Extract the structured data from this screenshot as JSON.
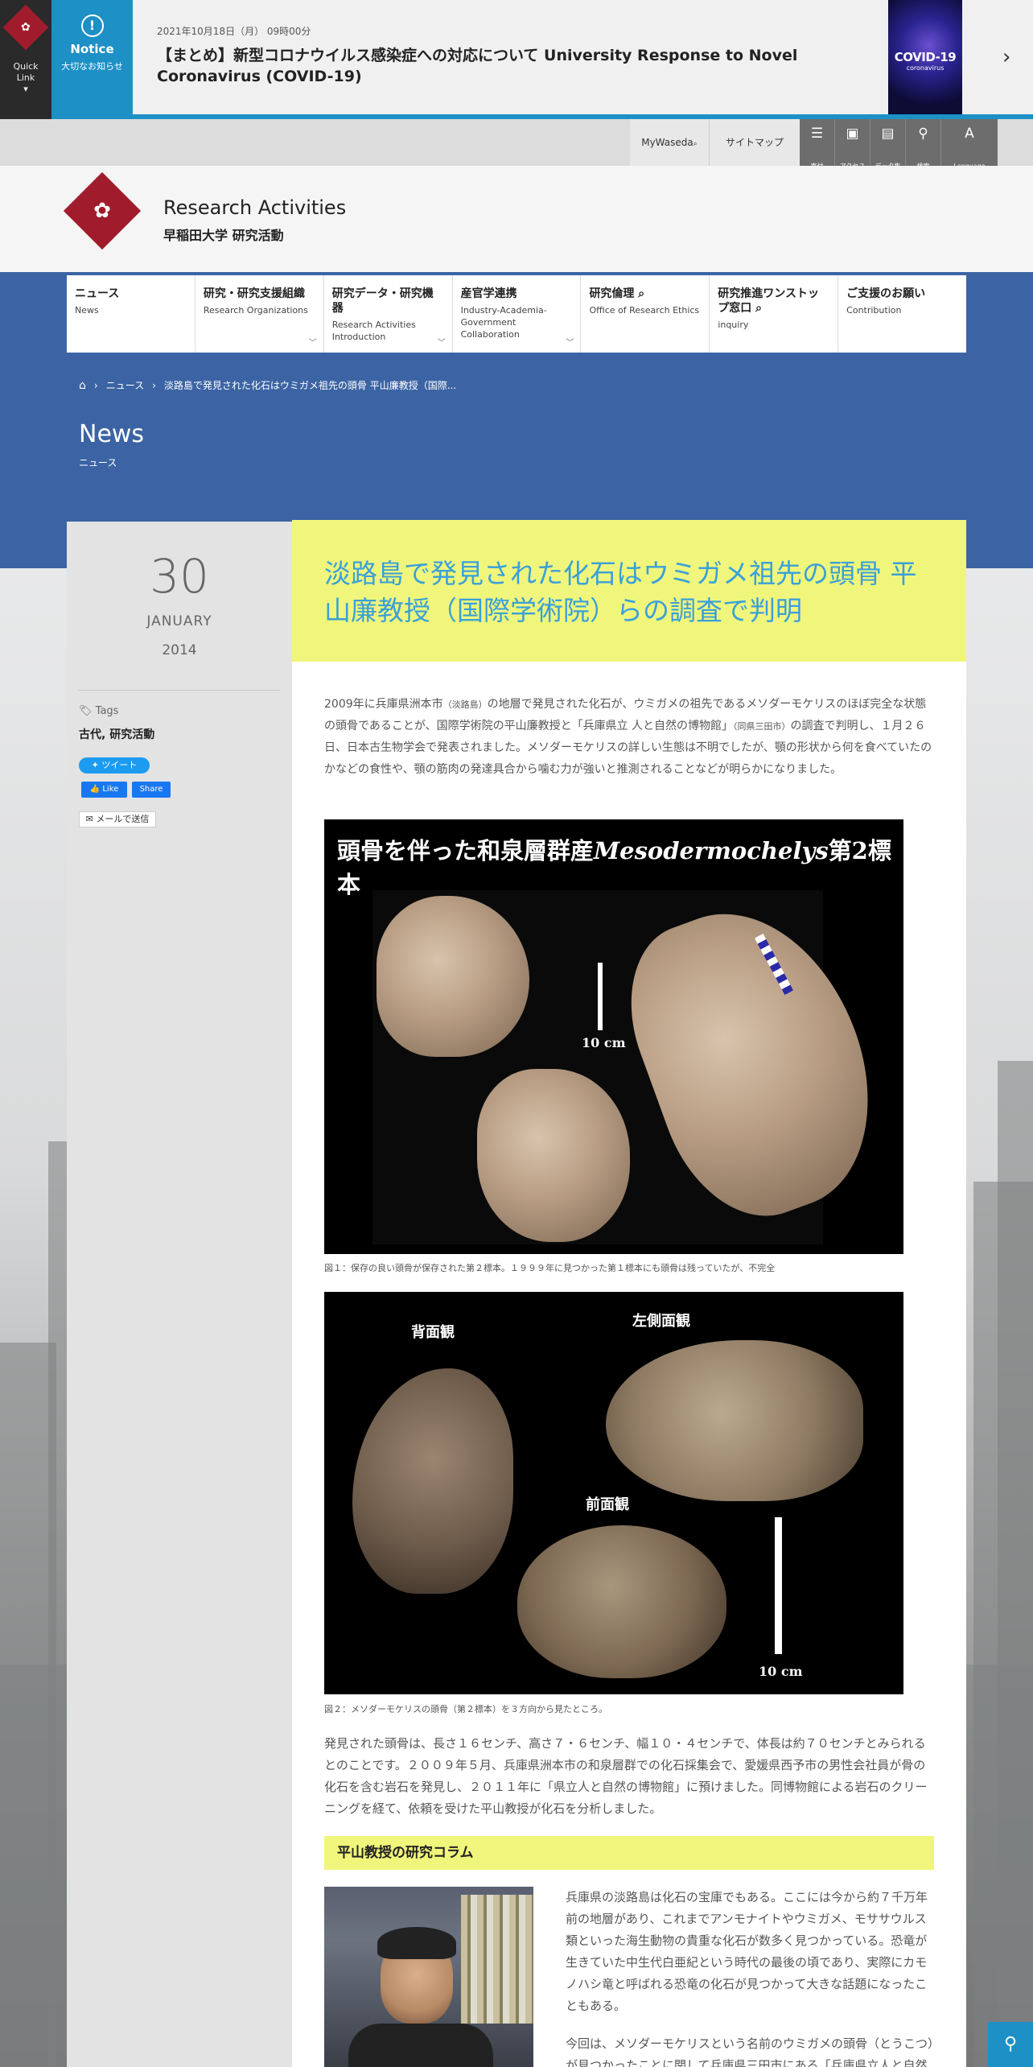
{
  "quick_link": {
    "label_line1": "Quick",
    "label_line2": "Link",
    "arrow": "▾"
  },
  "notice": {
    "label": "Notice",
    "sublabel": "大切なお知らせ",
    "date": "2021年10月18日（月） 09時00分",
    "title": "【まとめ】新型コロナウイルス感染症への対応について University Response to Novel Coronavirus (COVID-19)",
    "image_title": "COVID-19",
    "image_sub": "coronavirus"
  },
  "utility": {
    "mywaseda": "MyWaseda",
    "sitemap": "サイトマップ",
    "icons": [
      {
        "name": "kifu",
        "label": "寄付",
        "icon": "database-icon"
      },
      {
        "name": "access",
        "label": "アクセス",
        "icon": "bus-icon"
      },
      {
        "name": "data",
        "label": "データ集",
        "icon": "document-icon"
      },
      {
        "name": "search",
        "label": "検索",
        "icon": "search-icon"
      },
      {
        "name": "language",
        "label": "Language",
        "icon": "language-icon"
      }
    ]
  },
  "header": {
    "title": "Research Activities",
    "subtitle": "早稲田大学 研究活動"
  },
  "nav": [
    {
      "jp": "ニュース",
      "en": "News",
      "dropdown": false
    },
    {
      "jp": "研究・研究支援組織",
      "en": "Research Organizations",
      "dropdown": true
    },
    {
      "jp": "研究データ・研究機器",
      "en": "Research Activities Introduction",
      "dropdown": true
    },
    {
      "jp": "産官学連携",
      "en": "Industry-Academia-Government Collaboration",
      "dropdown": true
    },
    {
      "jp": "研究倫理 ⌕",
      "en": "Office of Research Ethics",
      "dropdown": false
    },
    {
      "jp": "研究推進ワンストップ窓口 ⌕",
      "en": "inquiry",
      "dropdown": false
    },
    {
      "jp": "ご支援のお願い",
      "en": "Contribution",
      "dropdown": false
    }
  ],
  "breadcrumb": {
    "home": "⌂",
    "news": "ニュース",
    "current": "淡路島で発見された化石はウミガメ祖先の頭骨 平山廉教授（国際..."
  },
  "section": {
    "title": "News",
    "subtitle": "ニュース"
  },
  "date": {
    "day": "30",
    "month": "JANUARY",
    "year": "2014"
  },
  "tags": {
    "label": "Tags",
    "values": "古代, 研究活動"
  },
  "share": {
    "tweet": "ツイート",
    "like": "Like",
    "share": "Share",
    "mail": "メールで送信"
  },
  "article": {
    "title": "淡路島で発見された化石はウミガメ祖先の頭骨 平山廉教授（国際学術院）らの調査で判明",
    "lead_1": "2009年に兵庫県洲本市",
    "lead_1s": "（淡路島）",
    "lead_2": "の地層で発見された化石が、ウミガメの祖先であるメソダーモケリスのほぼ完全な状態の頭骨であることが、国際学術院の平山廉教授と「兵庫県立 人と自然の博物館」",
    "lead_2s": "（同県三田市）",
    "lead_3": "の調査で判明し、１月２６日、日本古生物学会で発表されました。メソダーモケリスの詳しい生態は不明でしたが、顎の形状から何を食べていたのかなどの食性や、顎の筋肉の発達具合から噛む力が強いと推測されることなどが明らかになりました。",
    "fig1_heading": "頭骨を伴った和泉層群産",
    "fig1_heading_italic": "Mesodermochelys",
    "fig1_heading_end": "第2標本",
    "fig1_scale": "10 cm",
    "fig1_caption": "図１：保存の良い頭骨が保存された第２標本。１９９９年に見つかった第１標本にも頭骨は残っていたが、不完全",
    "fig2_labels": {
      "back": "背面観",
      "left": "左側面観",
      "front": "前面観"
    },
    "fig2_scale": "10 cm",
    "fig2_caption": "図２：メソダーモケリスの頭骨（第２標本）を３方向から見たところ。",
    "body": "発見された頭骨は、長さ１６センチ、高さ７・６センチ、幅１０・４センチで、体長は約７０センチとみられるとのことです。２００９年５月、兵庫県洲本市の和泉層群での化石採集会で、愛媛県西予市の男性会社員が骨の化石を含む岩石を発見し、２０１１年に「県立人と自然の博物館」に預けました。同博物館による岩石のクリーニングを経て、依頼を受けた平山教授が化石を分析しました。",
    "column_heading": "平山教授の研究コラム",
    "column_p1": "兵庫県の淡路島は化石の宝庫でもある。ここには今から約７千万年前の地層があり、これまでアンモナイトやウミガメ、モササウルス類といった海生動物の貴重な化石が数多く見つかっている。恐竜が生きていた中生代白亜紀という時代の最後の頃であり、実際にカモノハシ竜と呼ばれる恐竜の化石が見つかって大きな話題になったこともある。",
    "column_p2": "今回は、メソダーモケリスという名前のウミガメの頭骨（とうこつ）が見つかったことに関して兵庫県三田市にある「兵庫県立人と自然"
  },
  "colors": {
    "brand_red": "#a01c2c",
    "band_blue": "#3c64a4",
    "accent_blue": "#1d90c6",
    "title_yellow": "#f0f67b",
    "title_text": "#3aa0d8"
  }
}
